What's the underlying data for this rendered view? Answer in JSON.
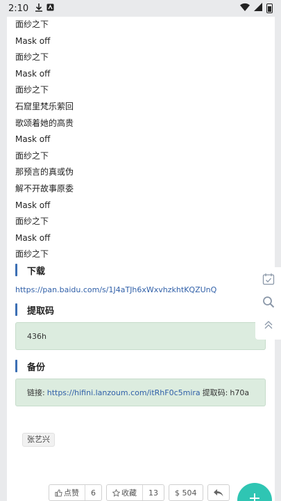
{
  "status_bar": {
    "time": "2:10"
  },
  "lyrics": [
    "面纱之下",
    "Mask off",
    "面纱之下",
    "Mask off",
    "面纱之下",
    "石窟里梵乐萦回",
    "歌颂着她的高贵",
    "Mask off",
    "面纱之下",
    "那预言的真或伪",
    "解不开故事原委",
    "Mask off",
    "面纱之下",
    "Mask off",
    "面纱之下"
  ],
  "download": {
    "title": "下载",
    "link": "https://pan.baidu.com/s/1J4aTJh6xWxvhzkhtKQZUnQ"
  },
  "extract": {
    "title": "提取码",
    "code": "436h"
  },
  "backup": {
    "title": "备份",
    "label": "链接:",
    "url": "https://hifini.lanzoum.com/itRhF0c5mira",
    "code_label": "提取码:",
    "code": "h70a"
  },
  "tag": "张艺兴",
  "actions": {
    "like_label": "点赞",
    "like_count": "6",
    "fav_label": "收藏",
    "fav_count": "13",
    "coin_label": "$ 504"
  },
  "fab_label": "+"
}
